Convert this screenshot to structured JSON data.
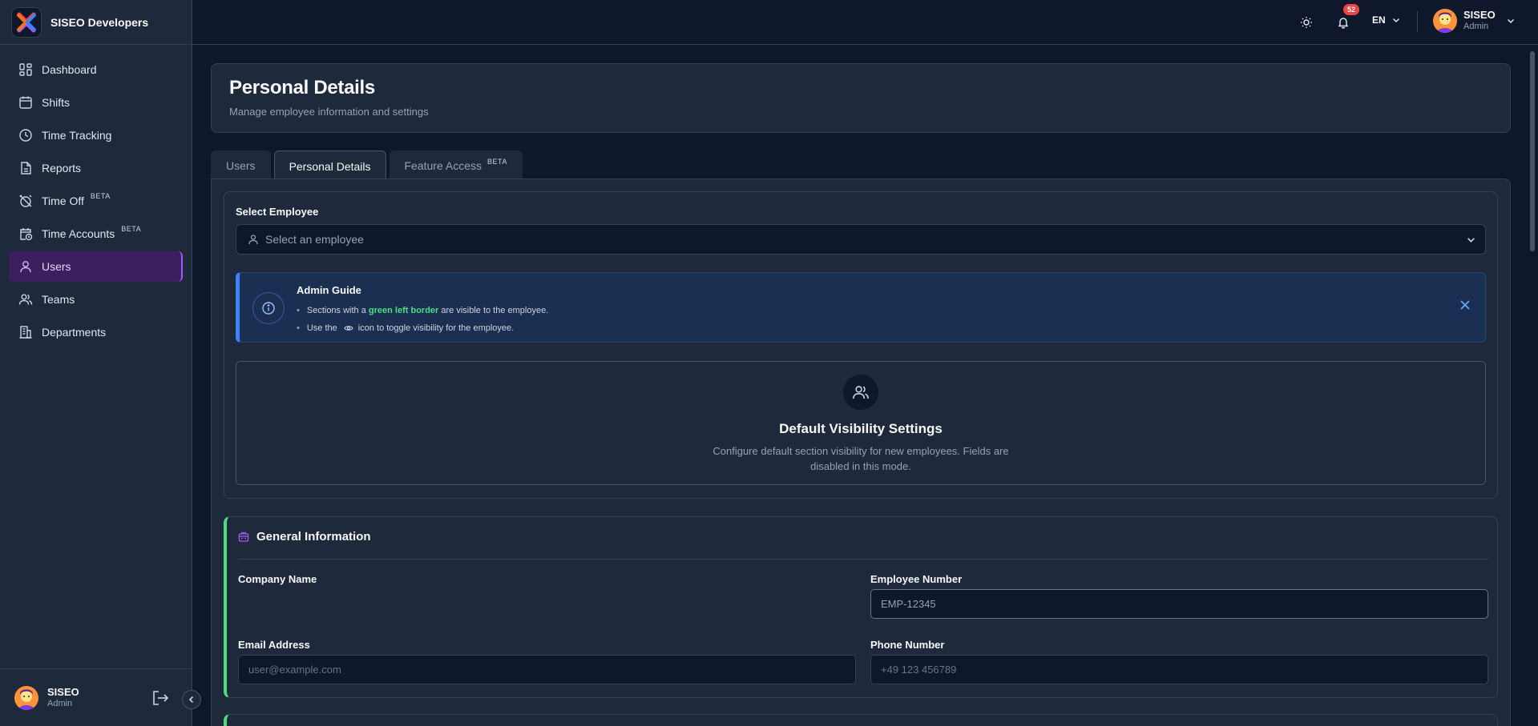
{
  "brand": {
    "name": "SISEO Developers"
  },
  "sidebar": {
    "items": [
      {
        "label": "Dashboard",
        "icon": "dashboard-icon"
      },
      {
        "label": "Shifts",
        "icon": "calendar-icon"
      },
      {
        "label": "Time Tracking",
        "icon": "clock-icon"
      },
      {
        "label": "Reports",
        "icon": "report-icon"
      },
      {
        "label": "Time Off",
        "icon": "alarm-off-icon",
        "badge": "BETA"
      },
      {
        "label": "Time Accounts",
        "icon": "calendar-clock-icon",
        "badge": "BETA"
      },
      {
        "label": "Users",
        "icon": "user-icon",
        "active": true
      },
      {
        "label": "Teams",
        "icon": "users-icon"
      },
      {
        "label": "Departments",
        "icon": "building-icon"
      }
    ],
    "user": {
      "name": "SISEO",
      "role": "Admin"
    }
  },
  "topbar": {
    "notifications_count": "52",
    "language": "EN",
    "user": {
      "name": "SISEO",
      "role": "Admin"
    }
  },
  "page": {
    "title": "Personal Details",
    "subtitle": "Manage employee information and settings"
  },
  "tabs": [
    {
      "label": "Users"
    },
    {
      "label": "Personal Details",
      "active": true
    },
    {
      "label": "Feature Access",
      "badge": "BETA"
    }
  ],
  "employee_select": {
    "label": "Select Employee",
    "placeholder": "Select an employee"
  },
  "admin_guide": {
    "title": "Admin Guide",
    "line1_prefix": "Sections with a",
    "line1_highlight": "green left border",
    "line1_suffix": "are visible to the employee.",
    "line2_prefix": "Use the",
    "line2_suffix": "icon to toggle visibility for the employee."
  },
  "default_visibility": {
    "title": "Default Visibility Settings",
    "description": "Configure default section visibility for new employees. Fields are disabled in this mode."
  },
  "general_information": {
    "title": "General Information",
    "company_name_label": "Company Name",
    "employee_number_label": "Employee Number",
    "employee_number_placeholder": "EMP-12345",
    "email_label": "Email Address",
    "email_placeholder": "user@example.com",
    "phone_label": "Phone Number",
    "phone_placeholder": "+49 123 456789"
  },
  "colors": {
    "accent": "#a855f7",
    "visible_border": "#4ade80",
    "info_border": "#3b82f6",
    "badge": "#ef4444"
  }
}
